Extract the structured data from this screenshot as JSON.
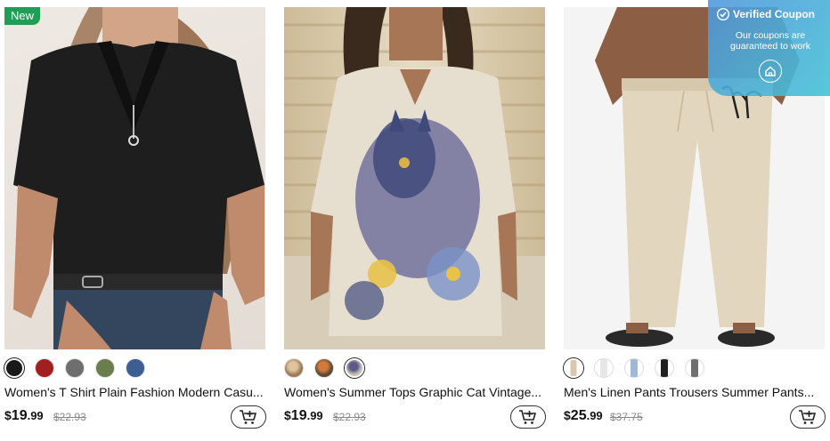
{
  "products": [
    {
      "badge": "New",
      "title": "Women's T Shirt Plain Fashion Modern Casu...",
      "price_currency": "$",
      "price_main": "19",
      "price_cents": ".99",
      "old_price": "$22.93",
      "swatch_colors": [
        "#1a1a1a",
        "#a21f1f",
        "#6e6e6e",
        "#6a7d4c",
        "#3d5e92"
      ],
      "image_icon": "black-v-neck-tshirt-photo"
    },
    {
      "title": "Women's Summer Tops Graphic Cat Vintage...",
      "price_currency": "$",
      "price_main": "19",
      "price_cents": ".99",
      "old_price": "$22.93",
      "swatch_colors": [
        "#9a7a5a",
        "#5b4838",
        "#c8bfb3"
      ],
      "image_icon": "cat-print-blouse-photo"
    },
    {
      "title": "Men's Linen Pants Trousers Summer Pants...",
      "price_currency": "$",
      "price_main": "25",
      "price_cents": ".99",
      "old_price": "$37.75",
      "swatch_colors": [
        "#d8c8ac",
        "#e7e7e7",
        "#9fb8d6",
        "#202020",
        "#6f6f6f"
      ],
      "image_icon": "linen-pants-photo"
    }
  ],
  "coupon": {
    "title": "Verified Coupon",
    "subtitle": "Our coupons are guaranteed to work",
    "check_icon": "verified-check-icon",
    "home_icon": "home-icon"
  },
  "colors": {
    "badge_green": "#1f9e55",
    "coupon_blue": "#4fa0dc"
  }
}
